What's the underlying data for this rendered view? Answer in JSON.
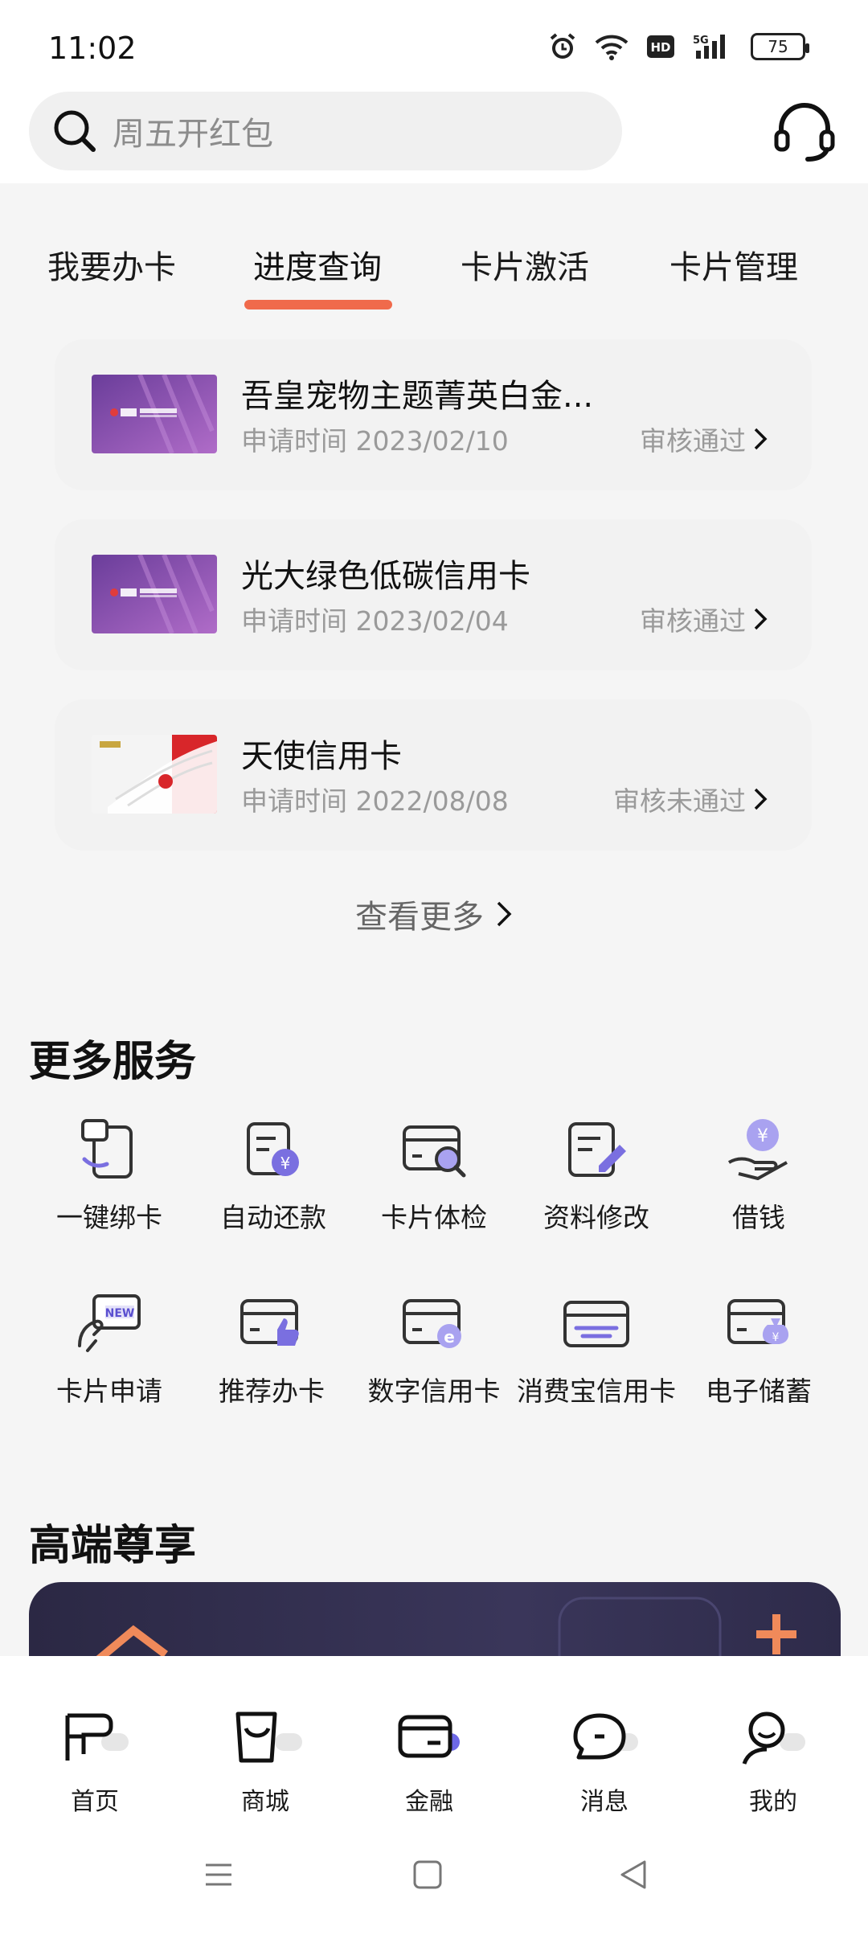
{
  "status_bar": {
    "time": "11:02",
    "battery": "75",
    "network": "5G"
  },
  "search": {
    "placeholder": "周五开红包"
  },
  "tabs": [
    {
      "label": "我要办卡"
    },
    {
      "label": "进度查询"
    },
    {
      "label": "卡片激活"
    },
    {
      "label": "卡片管理"
    }
  ],
  "active_tab": "进度查询",
  "applications": [
    {
      "name": "吾皇宠物主题菁英白金...",
      "date": "申请时间 2023/02/10",
      "status": "审核通过"
    },
    {
      "name": "光大绿色低碳信用卡",
      "date": "申请时间 2023/02/04",
      "status": "审核通过"
    },
    {
      "name": "天使信用卡",
      "date": "申请时间 2022/08/08",
      "status": "审核未通过"
    }
  ],
  "view_more": "查看更多",
  "more_services": {
    "title": "更多服务",
    "items": [
      {
        "label": "一键绑卡",
        "icon": "bind-card-icon"
      },
      {
        "label": "自动还款",
        "icon": "auto-repay-icon"
      },
      {
        "label": "卡片体检",
        "icon": "card-check-icon"
      },
      {
        "label": "资料修改",
        "icon": "edit-info-icon"
      },
      {
        "label": "借钱",
        "icon": "borrow-icon"
      },
      {
        "label": "卡片申请",
        "icon": "card-apply-icon"
      },
      {
        "label": "推荐办卡",
        "icon": "recommend-card-icon"
      },
      {
        "label": "数字信用卡",
        "icon": "digital-card-icon"
      },
      {
        "label": "消费宝信用卡",
        "icon": "consume-card-icon"
      },
      {
        "label": "电子储蓄",
        "icon": "e-savings-icon"
      }
    ]
  },
  "premium": {
    "title": "高端尊享"
  },
  "bottom_nav": [
    {
      "label": "首页",
      "icon": "home-icon"
    },
    {
      "label": "商城",
      "icon": "mall-icon"
    },
    {
      "label": "金融",
      "icon": "finance-icon"
    },
    {
      "label": "消息",
      "icon": "message-icon"
    },
    {
      "label": "我的",
      "icon": "profile-icon"
    }
  ],
  "colors": {
    "accent": "#f06a4b",
    "icon_purple": "#7a6fe0",
    "card_purple": "#8a4fb0"
  }
}
